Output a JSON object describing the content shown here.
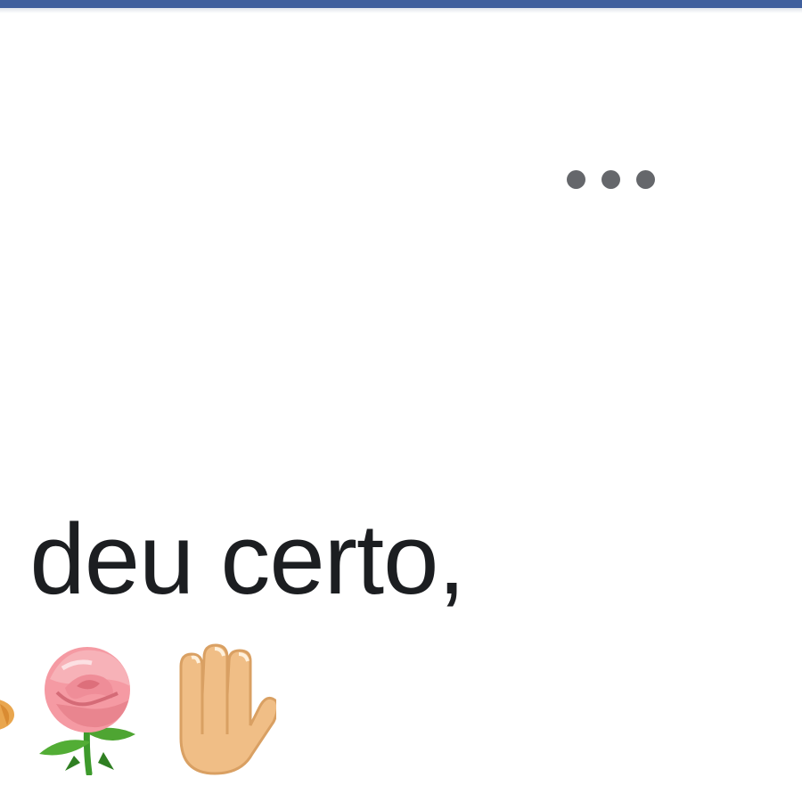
{
  "header": {
    "bar_color": "#3f5f9d"
  },
  "post": {
    "more_options_icon": "more-horizontal-icon",
    "text": "o deu certo,",
    "emojis": [
      "partial-emoji-icon",
      "rose-icon",
      "raised-hand-icon"
    ]
  },
  "colors": {
    "text": "#1c1e21",
    "icon_gray": "#65676b",
    "background": "#ffffff"
  }
}
